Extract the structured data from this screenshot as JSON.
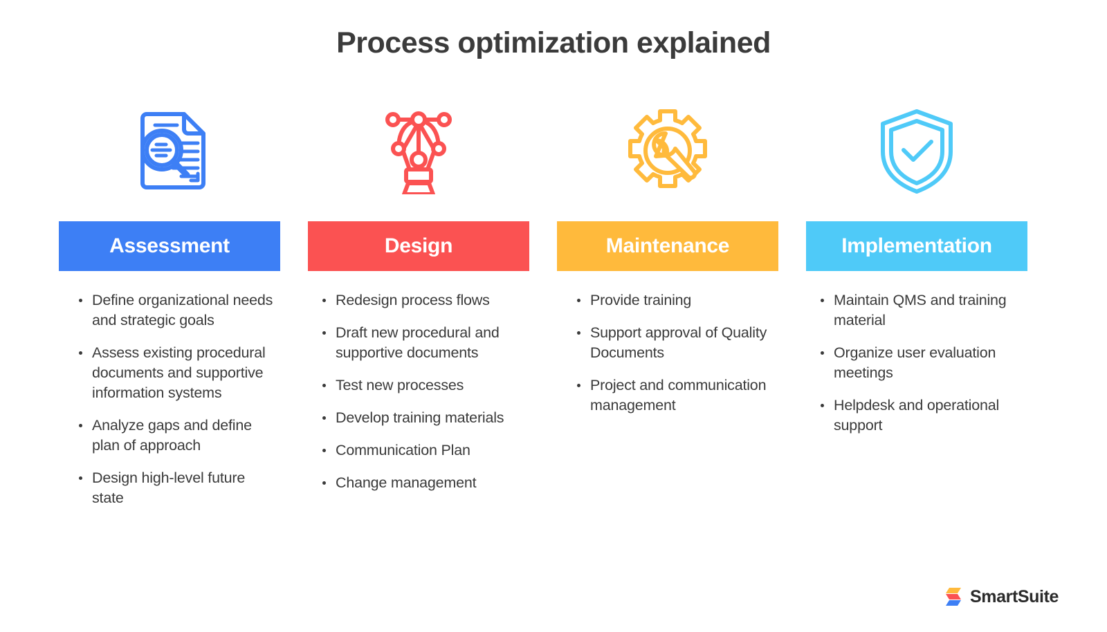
{
  "title": "Process optimization explained",
  "colors": {
    "assessment": "#3d7ff5",
    "design": "#fb5252",
    "maintenance": "#ffba3c",
    "implementation": "#4fcaf8",
    "text": "#3a3a3a",
    "title": "#3b3b3b",
    "logo_amber": "#ffba3c",
    "logo_red": "#fb5252",
    "logo_blue": "#3d7ff5"
  },
  "columns": [
    {
      "id": "assessment",
      "label": "Assessment",
      "icon": "document-magnifier-icon",
      "color": "#3d7ff5",
      "bullets": [
        "Define organizational needs and strategic goals",
        "Assess existing procedural documents and supportive information systems",
        "Analyze gaps and define plan of approach",
        "Design high-level future state"
      ]
    },
    {
      "id": "design",
      "label": "Design",
      "icon": "pen-tool-icon",
      "color": "#fb5252",
      "bullets": [
        "Redesign process flows",
        "Draft new procedural and supportive documents",
        "Test new processes",
        "Develop training materials",
        "Communication Plan",
        "Change management"
      ]
    },
    {
      "id": "maintenance",
      "label": "Maintenance",
      "icon": "gear-wrench-icon",
      "color": "#ffba3c",
      "bullets": [
        "Provide training",
        "Support approval of Quality Documents",
        "Project and communication management"
      ]
    },
    {
      "id": "implementation",
      "label": "Implementation",
      "icon": "shield-check-icon",
      "color": "#4fcaf8",
      "bullets": [
        "Maintain QMS and training material",
        "Organize user evaluation meetings",
        "Helpdesk and operational support"
      ]
    }
  ],
  "logo": {
    "mark": "smartsuite-logo-mark",
    "text": "SmartSuite"
  }
}
